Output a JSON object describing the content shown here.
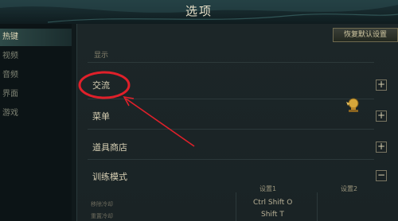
{
  "header": {
    "title": "选项"
  },
  "sidebar": {
    "items": [
      {
        "label": "热键",
        "active": true
      },
      {
        "label": "视频",
        "active": false
      },
      {
        "label": "音频",
        "active": false
      },
      {
        "label": "界面",
        "active": false
      },
      {
        "label": "游戏",
        "active": false
      }
    ]
  },
  "toolbar": {
    "restore_label": "恢复默认设置"
  },
  "sections": [
    {
      "label": "显示",
      "toggle": ""
    },
    {
      "label": "交流",
      "toggle": "+"
    },
    {
      "label": "菜单",
      "toggle": "+"
    },
    {
      "label": "道具商店",
      "toggle": "+"
    },
    {
      "label": "训练模式",
      "toggle": "−"
    }
  ],
  "table": {
    "headers": [
      "设置1",
      "设置2"
    ],
    "rows": [
      {
        "name": "移除冷却",
        "key1": "Ctrl Shift O"
      },
      {
        "name": "重置冷却",
        "key1": "Shift T"
      }
    ]
  },
  "colors": {
    "highlight": "#e0202a",
    "accent": "#cfc6a0"
  }
}
